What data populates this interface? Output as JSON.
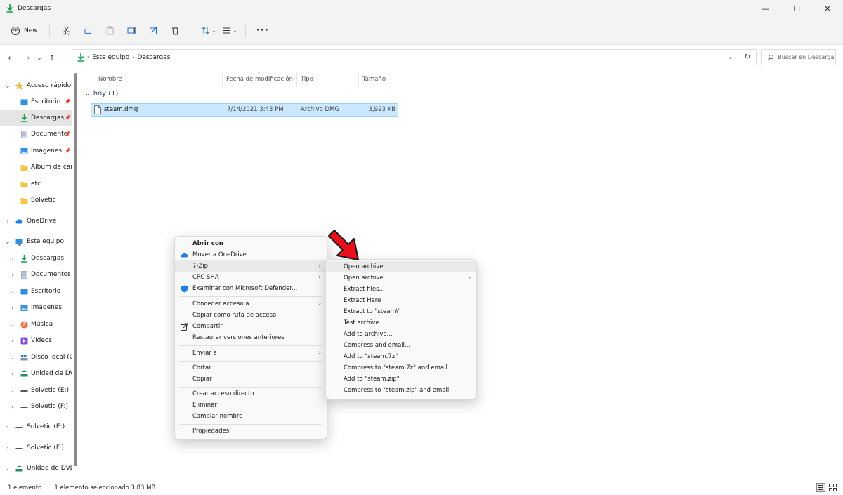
{
  "window": {
    "title": "Descargas",
    "controls": {
      "minimize": "—",
      "maximize": "☐",
      "close": "✕"
    }
  },
  "commandbar": {
    "new_label": "New"
  },
  "address": {
    "crumbs": [
      "Este equipo",
      "Descargas"
    ],
    "search_placeholder": "Buscar en Descarga..."
  },
  "sidebar": {
    "items": [
      {
        "label": "Acceso rápido"
      },
      {
        "label": "Escritorio"
      },
      {
        "label": "Descargas"
      },
      {
        "label": "Documento"
      },
      {
        "label": "Imágenes"
      },
      {
        "label": "Álbum de cám"
      },
      {
        "label": "etc"
      },
      {
        "label": "Solvetic"
      },
      {
        "label": "OneDrive"
      },
      {
        "label": "Este equipo"
      },
      {
        "label": "Descargas"
      },
      {
        "label": "Documentos"
      },
      {
        "label": "Escritorio"
      },
      {
        "label": "Imágenes"
      },
      {
        "label": "Música"
      },
      {
        "label": "Vídeos"
      },
      {
        "label": "Disco local (C:)"
      },
      {
        "label": "Unidad de DVD"
      },
      {
        "label": "Solvetic (E:)"
      },
      {
        "label": "Solvetic (F:)"
      },
      {
        "label": "Solvetic (E:)"
      },
      {
        "label": "Solvetic (F:)"
      },
      {
        "label": "Unidad de DVD ("
      }
    ]
  },
  "filelist": {
    "columns": [
      "Nombre",
      "Fecha de modificación",
      "Tipo",
      "Tamaño"
    ],
    "group_label": "hoy (1)",
    "files": [
      {
        "name": "steam.dmg",
        "modified": "7/14/2021 3:43 PM",
        "type": "Archivo DMG",
        "size": "3,923 KB"
      }
    ]
  },
  "statusbar": {
    "count": "1 elemento",
    "selection": "1 elemento seleccionado  3.83 MB"
  },
  "context_menu": {
    "items": [
      {
        "label": "Abrir con"
      },
      {
        "label": "Mover a OneDrive"
      },
      {
        "label": "7-Zip"
      },
      {
        "label": "CRC SHA"
      },
      {
        "label": "Examinar con Microsoft Defender..."
      },
      {
        "label": "Conceder acceso a"
      },
      {
        "label": "Copiar como ruta de acceso"
      },
      {
        "label": "Compartir"
      },
      {
        "label": "Restaurar versiones anteriores"
      },
      {
        "label": "Enviar a"
      },
      {
        "label": "Cortar"
      },
      {
        "label": "Copiar"
      },
      {
        "label": "Crear acceso directo"
      },
      {
        "label": "Eliminar"
      },
      {
        "label": "Cambiar nombre"
      },
      {
        "label": "Propiedades"
      }
    ]
  },
  "zip_submenu": {
    "items": [
      {
        "label": "Open archive"
      },
      {
        "label": "Open archive"
      },
      {
        "label": "Extract files..."
      },
      {
        "label": "Extract Here"
      },
      {
        "label": "Extract to \"steam\\\""
      },
      {
        "label": "Test archive"
      },
      {
        "label": "Add to archive..."
      },
      {
        "label": "Compress and email..."
      },
      {
        "label": "Add to \"steam.7z\""
      },
      {
        "label": "Compress to \"steam.7z\" and email"
      },
      {
        "label": "Add to \"steam.zip\""
      },
      {
        "label": "Compress to \"steam.zip\" and email"
      }
    ]
  },
  "colors": {
    "accent": "#0078d4",
    "selection_bg": "#cce8ff",
    "folder": "#f4c542",
    "download_green": "#12a04a",
    "arrow_red": "#e8111c"
  }
}
